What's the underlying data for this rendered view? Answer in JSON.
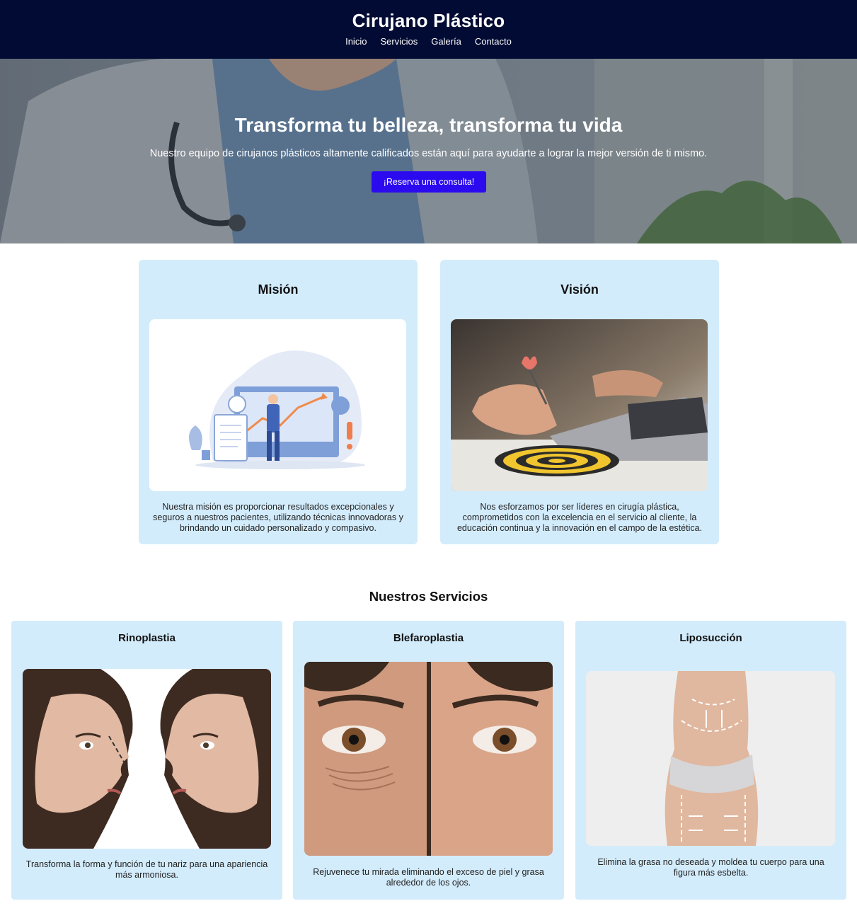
{
  "header": {
    "title": "Cirujano Plástico",
    "nav": [
      "Inicio",
      "Servicios",
      "Galería",
      "Contacto"
    ]
  },
  "hero": {
    "title": "Transforma tu belleza, transforma tu vida",
    "subtitle": "Nuestro equipo de cirujanos plásticos altamente calificados están aquí para ayudarte a lograr la mejor versión de ti mismo.",
    "cta_label": "¡Reserva una consulta!"
  },
  "mission": {
    "title": "Misión",
    "text": "Nuestra misión es proporcionar resultados excepcionales y seguros a nuestros pacientes, utilizando técnicas innovadoras y brindando un cuidado personalizado y compasivo."
  },
  "vision": {
    "title": "Visión",
    "text": "Nos esforzamos por ser líderes en cirugía plástica, comprometidos con la excelencia en el servicio al cliente, la educación continua y la innovación en el campo de la estética."
  },
  "services": {
    "title": "Nuestros Servicios",
    "items": [
      {
        "title": "Rinoplastia",
        "text": "Transforma la forma y función de tu nariz para una apariencia más armoniosa."
      },
      {
        "title": "Blefaroplastia",
        "text": "Rejuvenece tu mirada eliminando el exceso de piel y grasa alrededor de los ojos."
      },
      {
        "title": "Liposucción",
        "text": "Elimina la grasa no deseada y moldea tu cuerpo para una figura más esbelta."
      }
    ]
  },
  "colors": {
    "header_bg": "#020b33",
    "card_bg": "#d3ecfc",
    "cta_bg": "#2b0af0"
  }
}
